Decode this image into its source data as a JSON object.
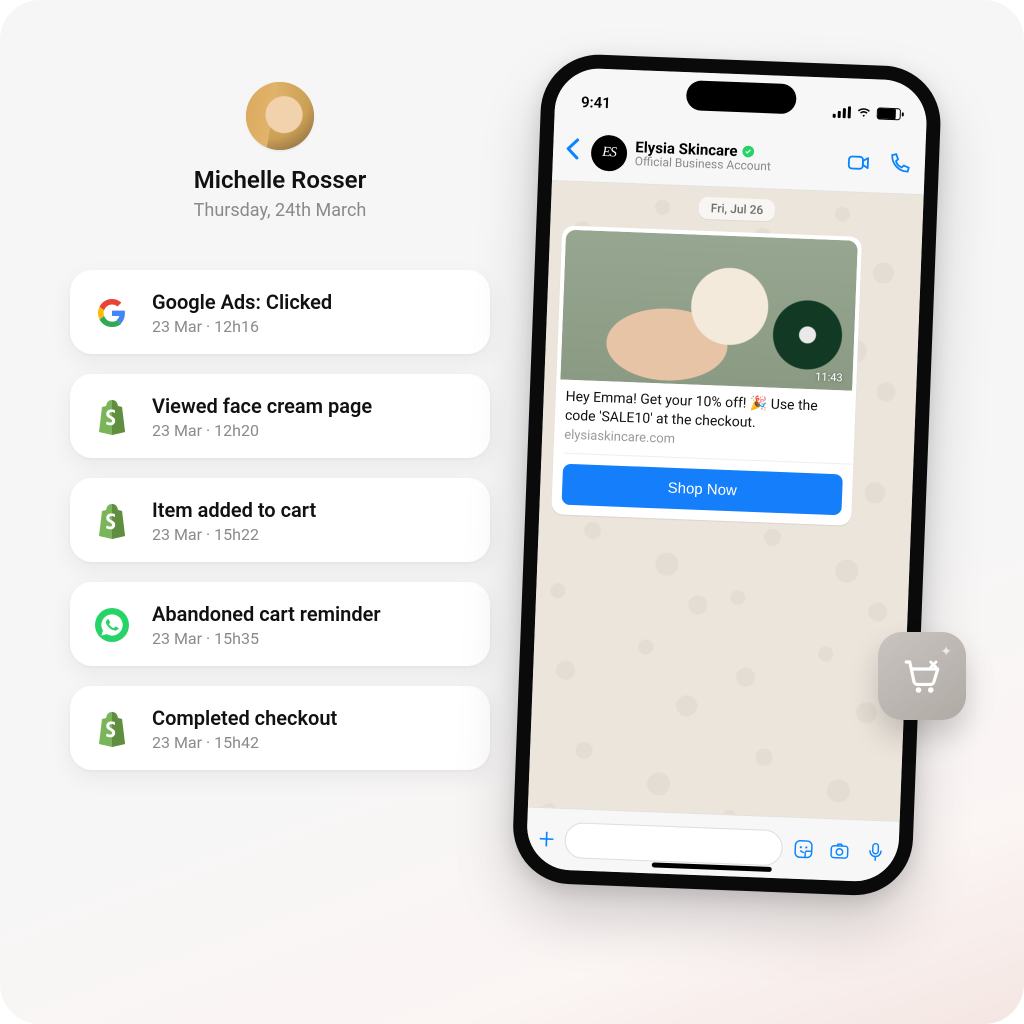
{
  "profile": {
    "name": "Michelle Rosser",
    "date": "Thursday, 24th March"
  },
  "feed": [
    {
      "icon": "google",
      "title": "Google Ads: Clicked",
      "meta": "23 Mar · 12h16"
    },
    {
      "icon": "shopify",
      "title": "Viewed face cream page",
      "meta": "23 Mar · 12h20"
    },
    {
      "icon": "shopify",
      "title": "Item added to cart",
      "meta": "23 Mar · 15h22"
    },
    {
      "icon": "whatsapp",
      "title": "Abandoned cart reminder",
      "meta": "23 Mar · 15h35"
    },
    {
      "icon": "shopify",
      "title": "Completed checkout",
      "meta": "23 Mar · 15h42"
    }
  ],
  "phone": {
    "status_time": "9:41",
    "chat": {
      "brand_initials": "ES",
      "brand_name": "Elysia Skincare",
      "brand_subtitle": "Official Business Account",
      "date_chip": "Fri, Jul 26",
      "media_time": "11:43",
      "message_text": "Hey Emma! Get your 10% off! 🎉 Use the code 'SALE10' at the checkout.",
      "message_link": "elysiaskincare.com",
      "cta_label": "Shop Now"
    }
  }
}
